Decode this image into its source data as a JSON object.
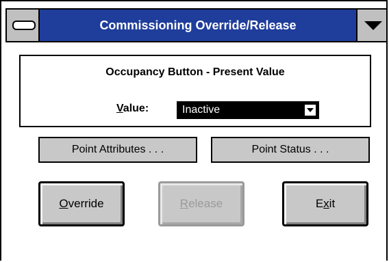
{
  "window": {
    "title": "Commissioning Override/Release"
  },
  "point": {
    "name": "Occupancy Button - Present Value",
    "value_label": "Value:",
    "value_label_mnemonic": "V",
    "value_label_rest": "alue:",
    "selected_value": "Inactive"
  },
  "buttons": {
    "point_attributes": "Point Attributes . . .",
    "point_status": "Point Status . . .",
    "override_mnemonic": "O",
    "override_rest": "verride",
    "release_mnemonic": "R",
    "release_rest": "elease",
    "exit_pre": "E",
    "exit_mnemonic": "x",
    "exit_rest": "it"
  },
  "icons": {
    "system_menu": "system-menu-icon",
    "minimize": "dropdown-arrow-icon"
  },
  "colors": {
    "title_bar": "#1f3d9b",
    "button_face": "#c8c8c8",
    "disabled_text": "#9a9a9a"
  }
}
